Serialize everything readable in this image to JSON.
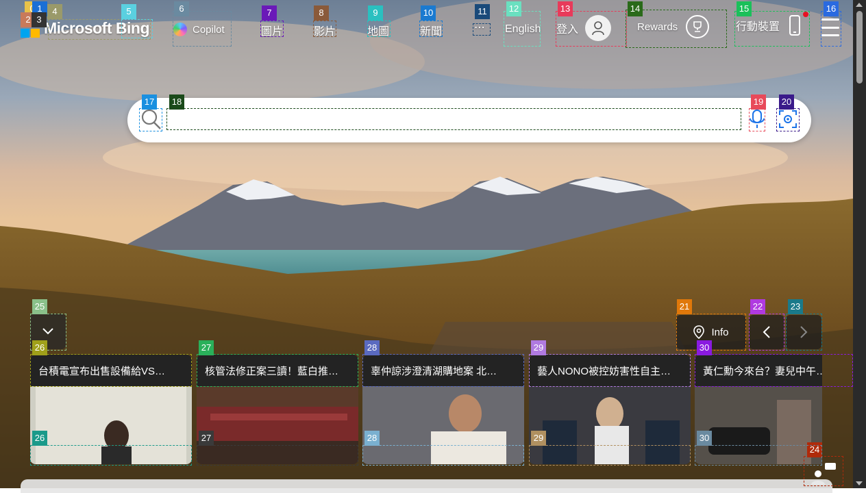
{
  "header": {
    "logo_text": "Microsoft Bing",
    "copilot_label": "Copilot",
    "nav": [
      {
        "label": "圖片"
      },
      {
        "label": "影片"
      },
      {
        "label": "地圖"
      },
      {
        "label": "新聞"
      },
      {
        "label": "⋯"
      }
    ],
    "language_label": "English",
    "signin_label": "登入",
    "rewards_label": "Rewards",
    "mobile_label": "行動裝置"
  },
  "search": {
    "value": "",
    "placeholder": ""
  },
  "info_label": "Info",
  "news": [
    {
      "title": "台積電宣布出售設備給VS…"
    },
    {
      "title": "核管法修正案三讀！藍白推…"
    },
    {
      "title": "辜仲諒涉澄清湖購地案 北…"
    },
    {
      "title": "藝人NONO被控妨害性自主…"
    },
    {
      "title": "黃仁勳今來台？妻兒中午…"
    }
  ],
  "badges": [
    "0",
    "1",
    "2",
    "3",
    "4",
    "5",
    "6",
    "7",
    "8",
    "9",
    "10",
    "11",
    "12",
    "13",
    "14",
    "15",
    "16",
    "17",
    "18",
    "19",
    "20",
    "21",
    "22",
    "23",
    "24",
    "25",
    "26",
    "27",
    "28",
    "29",
    "30"
  ],
  "colors": {
    "ms_red": "#f25022",
    "ms_green": "#7fba00",
    "ms_blue": "#00a4ef",
    "ms_yellow": "#ffb900"
  }
}
